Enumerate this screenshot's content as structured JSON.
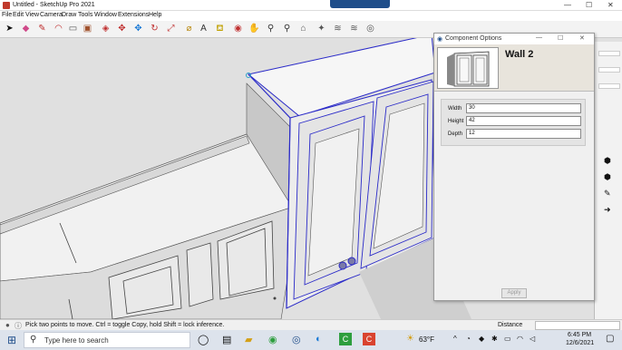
{
  "window": {
    "title": "Untitled - SketchUp Pro 2021",
    "minimize": "—",
    "maximize": "☐",
    "close": "✕"
  },
  "menu": [
    "File",
    "Edit",
    "View",
    "Camera",
    "Draw",
    "Tools",
    "Window",
    "Extensions",
    "Help"
  ],
  "toolbar_icons": [
    "select-icon",
    "eraser-icon",
    "line-icon",
    "arc-icon",
    "rectangle-icon",
    "push-pull-icon",
    "offset-icon",
    "move-icon",
    "rotate-icon",
    "scale-icon",
    "tape-measure-icon",
    "text-icon",
    "paint-bucket-icon",
    "orbit-icon",
    "pan-icon",
    "zoom-icon",
    "zoom-extents-icon",
    "warehouse-icon",
    "extension-warehouse-icon",
    "styles-icon",
    "layout-icon",
    "extensions-icon",
    "profile-icon"
  ],
  "dialog": {
    "title": "Component Options",
    "component_name": "Wall 2",
    "fields": [
      {
        "label": "Width",
        "value": "30"
      },
      {
        "label": "Height",
        "value": "42"
      },
      {
        "label": "Depth",
        "value": "12"
      }
    ],
    "apply_label": "Apply"
  },
  "status": {
    "hint": "Pick two points to move.  Ctrl = toggle Copy, hold Shift = lock inference.",
    "measure_label": "Distance"
  },
  "taskbar": {
    "search_placeholder": "Type here to search",
    "weather": "63°F",
    "time": "6:45 PM",
    "date": "12/6/2021"
  },
  "colors": {
    "accent": "#1f4e8a",
    "selection": "#2a2ac8"
  }
}
